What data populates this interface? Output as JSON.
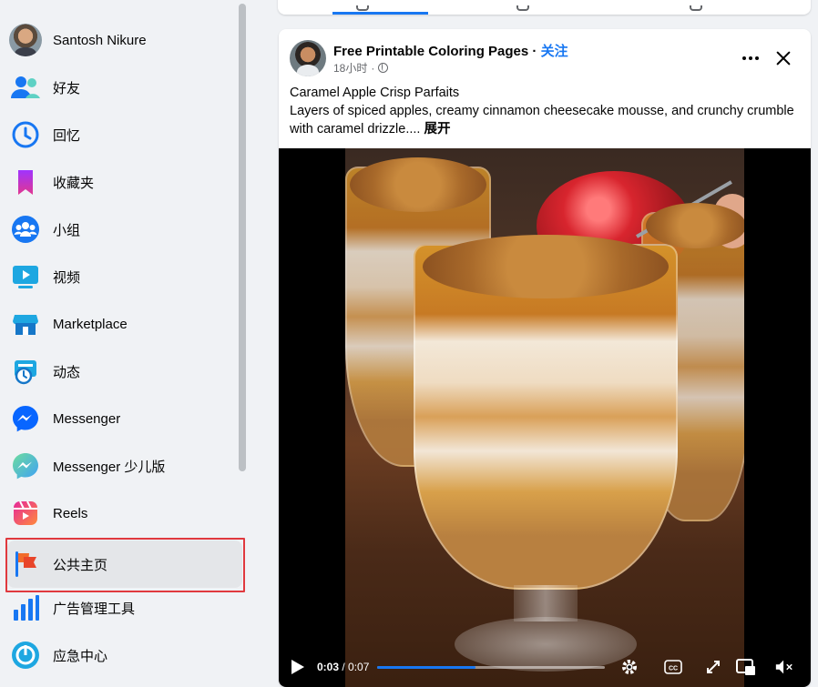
{
  "sidebar": {
    "items": [
      {
        "label": "Santosh Nikure",
        "icon": "user-avatar"
      },
      {
        "label": "好友",
        "icon": "friends-icon"
      },
      {
        "label": "回忆",
        "icon": "memories-icon"
      },
      {
        "label": "收藏夹",
        "icon": "saved-icon"
      },
      {
        "label": "小组",
        "icon": "groups-icon"
      },
      {
        "label": "视频",
        "icon": "video-icon"
      },
      {
        "label": "Marketplace",
        "icon": "marketplace-icon"
      },
      {
        "label": "动态",
        "icon": "feeds-icon"
      },
      {
        "label": "Messenger",
        "icon": "messenger-icon"
      },
      {
        "label": "Messenger 少儿版",
        "icon": "messenger-kids-icon"
      },
      {
        "label": "Reels",
        "icon": "reels-icon"
      },
      {
        "label": "公共主页",
        "icon": "pages-flag-icon"
      },
      {
        "label": "广告管理工具",
        "icon": "ads-manager-icon"
      },
      {
        "label": "应急中心",
        "icon": "crisis-response-icon"
      }
    ],
    "active_index": 11
  },
  "post": {
    "page_name": "Free Printable Coloring Pages",
    "separator": " · ",
    "follow_label": "关注",
    "time": "18小时",
    "time_dot": " · ",
    "title": "Caramel Apple Crisp Parfaits",
    "body": "Layers of spiced apples, creamy cinnamon cheesecake mousse, and crunchy crumble with caramel drizzle.... ",
    "see_more": "展开",
    "video": {
      "current_time": "0:03",
      "duration": " / 0:07",
      "progress": 0.43
    }
  },
  "colors": {
    "accent": "#1877f2",
    "highlight_border": "#e0393e"
  }
}
